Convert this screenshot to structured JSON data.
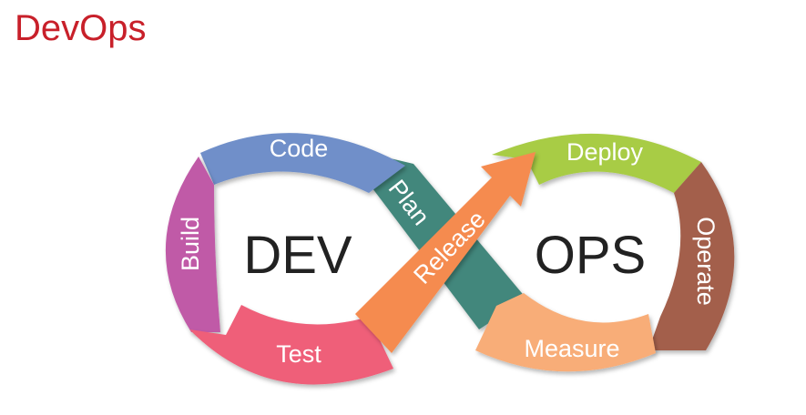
{
  "slide": {
    "title": "DevOps"
  },
  "diagram": {
    "dev_label": "DEV",
    "ops_label": "OPS",
    "segments": {
      "code": {
        "label": "Code",
        "color": "#6f8fc9"
      },
      "build": {
        "label": "Build",
        "color": "#c05aa7"
      },
      "test": {
        "label": "Test",
        "color": "#ef5f79"
      },
      "plan": {
        "label": "Plan",
        "color": "#43877b"
      },
      "release": {
        "label": "Release",
        "color": "#f58b4f"
      },
      "deploy": {
        "label": "Deploy",
        "color": "#a8cc44"
      },
      "operate": {
        "label": "Operate",
        "color": "#a35e4b"
      },
      "measure": {
        "label": "Measure",
        "color": "#f8ad78"
      }
    }
  }
}
